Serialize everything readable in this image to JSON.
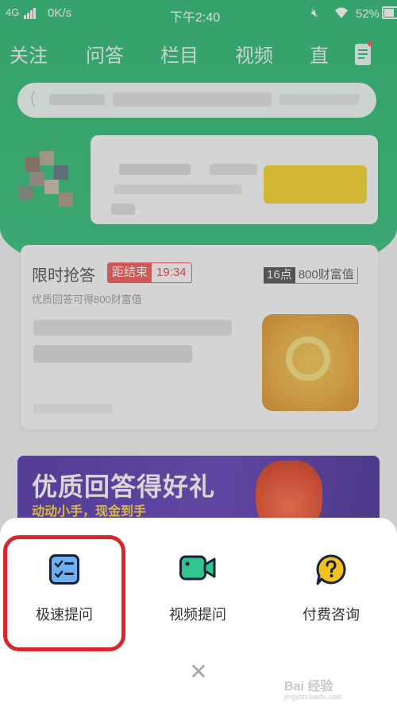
{
  "status_bar": {
    "signal": "4G",
    "speed": "0K/s",
    "time": "下午2:40",
    "battery": "52%"
  },
  "nav": {
    "tabs": [
      "关注",
      "问答",
      "栏目",
      "视频",
      "直"
    ]
  },
  "flash_card": {
    "title": "限时抢答",
    "countdown_label": "距结束",
    "countdown_time": "19:34",
    "reward_hour": "16点",
    "reward_text": "800财富值",
    "subtitle": "优质回答可得800财富值"
  },
  "banner": {
    "title": "优质回答得好礼",
    "subtitle": "动动小手，现金到手"
  },
  "sheet": {
    "options": [
      {
        "label": "极速提问",
        "icon": "checklist-icon"
      },
      {
        "label": "视频提问",
        "icon": "video-camera-icon"
      },
      {
        "label": "付费咨询",
        "icon": "question-bubble-icon"
      }
    ],
    "close_glyph": "✕"
  },
  "watermark": {
    "text": "Bai 经验",
    "url": "jingyan.baidu.com"
  },
  "colors": {
    "green": "#23b96d",
    "highlight": "#d7272b",
    "icon_blue": "#5aa0e6",
    "icon_green": "#2fc58c",
    "icon_yellow": "#f5c21b"
  }
}
